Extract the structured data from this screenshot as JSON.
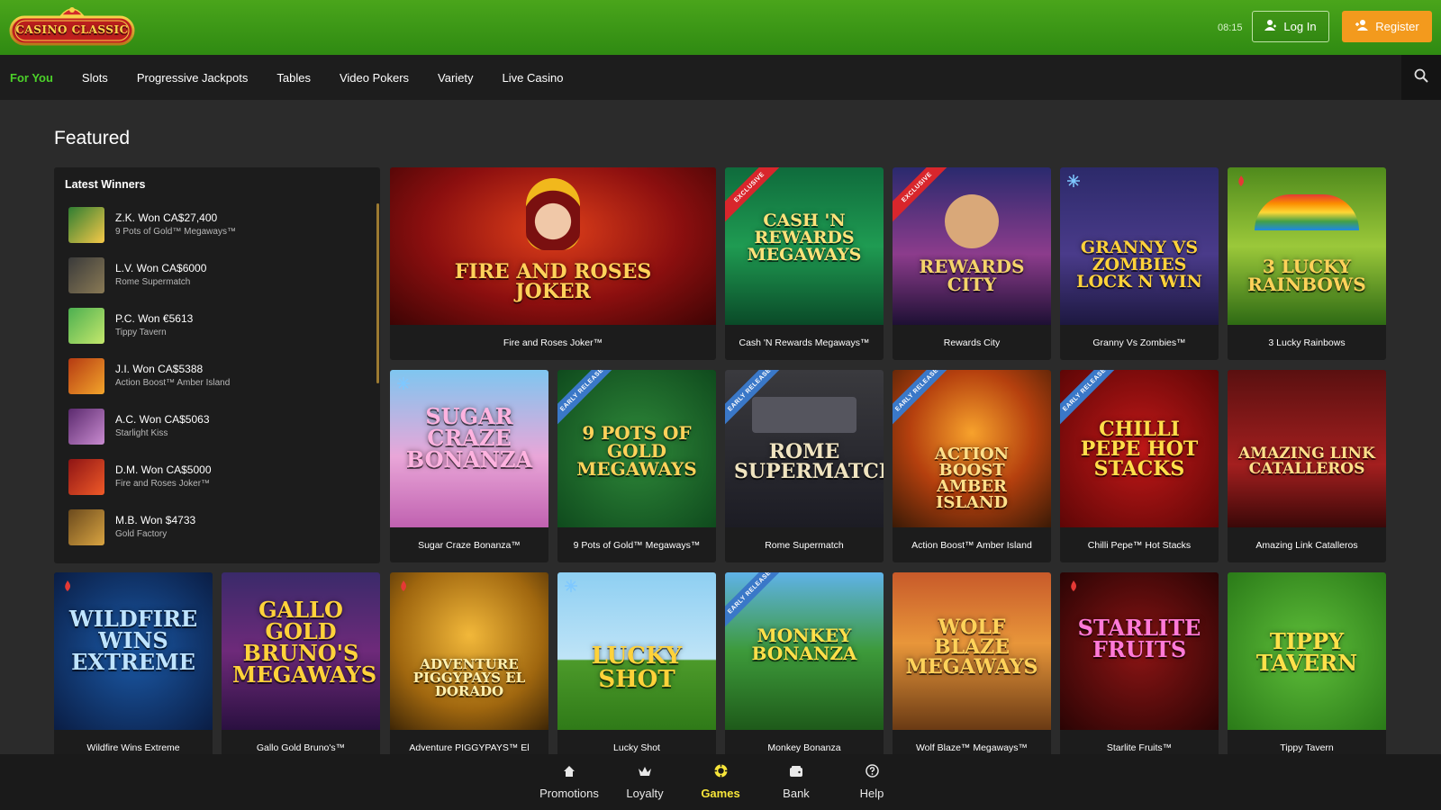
{
  "header": {
    "logo_text": "CASINO CLASSIC",
    "time": "08:15",
    "login_label": "Log In",
    "register_label": "Register",
    "brand_color": "#3f9c18",
    "register_color": "#f39a1d"
  },
  "nav": {
    "items": [
      "For You",
      "Slots",
      "Progressive Jackpots",
      "Tables",
      "Video Pokers",
      "Variety",
      "Live Casino"
    ],
    "active": "For You",
    "search_icon": "search-icon"
  },
  "featured": {
    "title": "Featured",
    "winners_title": "Latest Winners",
    "winners": [
      {
        "name": "Z.K. Won CA$27,400",
        "game": "9 Pots of Gold™ Megaways™"
      },
      {
        "name": "L.V. Won CA$6000",
        "game": "Rome Supermatch"
      },
      {
        "name": "P.C. Won €5613",
        "game": "Tippy Tavern"
      },
      {
        "name": "J.I. Won CA$5388",
        "game": "Action Boost™ Amber Island"
      },
      {
        "name": "A.C. Won CA$5063",
        "game": "Starlight Kiss"
      },
      {
        "name": "D.M. Won CA$5000",
        "game": "Fire and Roses Joker™"
      },
      {
        "name": "M.B. Won $4733",
        "game": "Gold Factory"
      }
    ]
  },
  "games": {
    "row1": [
      {
        "title": "Fire and Roses Joker™",
        "art": "FIRE AND ROSES JOKER"
      },
      {
        "title": "Cash 'N Rewards Megaways™",
        "art": "CASH 'N REWARDS MEGAWAYS",
        "ribbon": "EXCLUSIVE"
      },
      {
        "title": "Rewards City",
        "art": "REWARDS CITY",
        "ribbon": "EXCLUSIVE"
      },
      {
        "title": "Granny Vs Zombies™",
        "art": "GRANNY VS ZOMBIES LOCK N WIN"
      },
      {
        "title": "3 Lucky Rainbows",
        "art": "3 LUCKY RAINBOWS"
      }
    ],
    "row2": [
      {
        "title": "Sugar Craze Bonanza™",
        "art": "SUGAR CRAZE BONANZA"
      },
      {
        "title": "9 Pots of Gold™ Megaways™",
        "art": "9 POTS OF GOLD MEGAWAYS",
        "ribbon": "EARLY RELEASE"
      },
      {
        "title": "Rome Supermatch",
        "art": "ROME SUPERMATCH",
        "ribbon": "EARLY RELEASE"
      },
      {
        "title": "Action Boost™ Amber Island",
        "art": "ACTION BOOST AMBER ISLAND",
        "ribbon": "EARLY RELEASE"
      },
      {
        "title": "Chilli Pepe™ Hot Stacks",
        "art": "CHILLI PEPE HOT STACKS",
        "ribbon": "EARLY RELEASE"
      },
      {
        "title": "Amazing Link Catalleros",
        "art": "AMAZING LINK CATALLEROS"
      }
    ],
    "row3": [
      {
        "title": "Wildfire Wins Extreme",
        "art": "WILDFIRE WINS EXTREME"
      },
      {
        "title": "Gallo Gold Bruno's™",
        "art": "GALLO GOLD BRUNO'S MEGAWAYS"
      },
      {
        "title": "Adventure PIGGYPAYS™ El",
        "art": "ADVENTURE PIGGYPAYS EL DORADO"
      },
      {
        "title": "Lucky Shot",
        "art": "LUCKY SHOT"
      },
      {
        "title": "Monkey Bonanza",
        "art": "MONKEY BONANZA",
        "ribbon": "EARLY RELEASE"
      },
      {
        "title": "Wolf Blaze™ Megaways™",
        "art": "WOLF BLAZE MEGAWAYS"
      },
      {
        "title": "Starlite Fruits™",
        "art": "STARLITE FRUITS"
      },
      {
        "title": "Tippy Tavern",
        "art": "TIPPY TAVERN"
      }
    ]
  },
  "bottom_nav": {
    "items": [
      {
        "label": "Promotions",
        "icon": "home-icon"
      },
      {
        "label": "Loyalty",
        "icon": "crown-icon"
      },
      {
        "label": "Games",
        "icon": "chip-icon",
        "active": true
      },
      {
        "label": "Bank",
        "icon": "wallet-icon"
      },
      {
        "label": "Help",
        "icon": "help-icon"
      }
    ],
    "active_color": "#f7e53a"
  }
}
